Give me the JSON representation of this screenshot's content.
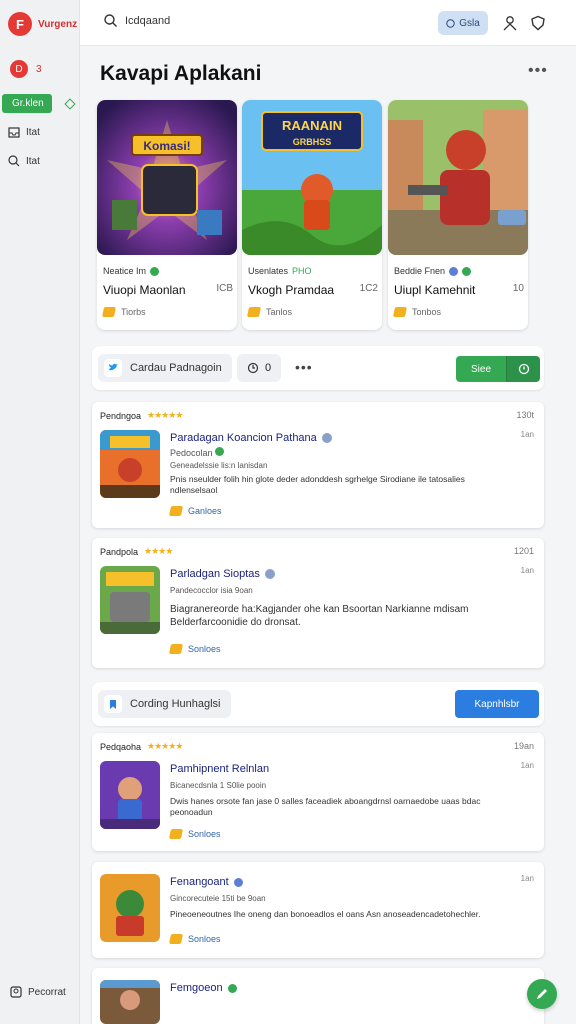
{
  "brand": {
    "name": "Vurgenz"
  },
  "sidebar": {
    "badge_count": "3",
    "items": [
      {
        "label": "Gr.klen"
      },
      {
        "label": "Itat"
      },
      {
        "label": "Itat"
      }
    ],
    "footer_label": "Pecorrat"
  },
  "topbar": {
    "search_text": "Icdqaand",
    "button_label": "Gsla"
  },
  "page": {
    "title": "Kavapi Aplakani"
  },
  "cards": [
    {
      "line1": "Neatice Im",
      "line2": "Viuopi Maonlan",
      "size": "ICB",
      "line3": "Tiorbs"
    },
    {
      "line1": "Usenlates",
      "tag": "PHO",
      "line2": "Vkogh Pramdaa",
      "size": "1C2",
      "line3": "Tanlos"
    },
    {
      "line1": "Beddie Fnen",
      "line2": "Uiupl Kamehnit",
      "size": "10",
      "line3": "Tonbos"
    }
  ],
  "toolbar1": {
    "chip_label": "Cardau Padnagoin",
    "count": "0",
    "button_label": "Siee"
  },
  "toolbar2": {
    "chip_label": "Cording Hunhaglsi",
    "button_label": "Kapnhlsbr"
  },
  "list": [
    {
      "category": "Pendngoa",
      "time": "130t",
      "time2": "1an",
      "title": "Paradagan Koancion Pathana",
      "sub": "Pedocolan",
      "sub2": "Geneadelssie lis:n lanisdan",
      "desc": "Pnis nseulder folih hin glote deder adonddesh sgrhelge Sirodiane ile tatosalies ndlenselsaol",
      "src": "Ganloes"
    },
    {
      "category": "Pandpola",
      "time": "1201",
      "time2": "1an",
      "title": "Parladgan Sioptas",
      "sub2": "Pandecocclor isia 9oan",
      "desc": "Biagranereorde ha:Kagjander ohe kan Bsoortan Narkianne mdisam Belderfarcoonidie do dronsat.",
      "src": "Sonloes"
    },
    {
      "category": "Pedqaoha",
      "time": "19an",
      "time2": "1an",
      "title": "Pamhipnent Relnlan",
      "sub2": "Bicanecdsnla 1 S0lie pooin",
      "desc": "Dwis hanes orsote fan jase 0 salles faceadiek aboangdrnsl oarnaedobe uaas bdac peonoadun",
      "src": "Sonloes"
    },
    {
      "category": "",
      "time": "",
      "time2": "1an",
      "title": "Fenangoant",
      "sub2": "Gincorecuteie 15ti be 9oan",
      "desc": "Pineoeneoutnes Ihe oneng dan bonoeadlos el oans Asn anoseadencadetohechler.",
      "src": "Sonloes"
    },
    {
      "title": "Femgoeon"
    }
  ],
  "colors": {
    "accent_green": "#34a853",
    "accent_blue": "#2b7de0",
    "brand_red": "#e53935"
  }
}
